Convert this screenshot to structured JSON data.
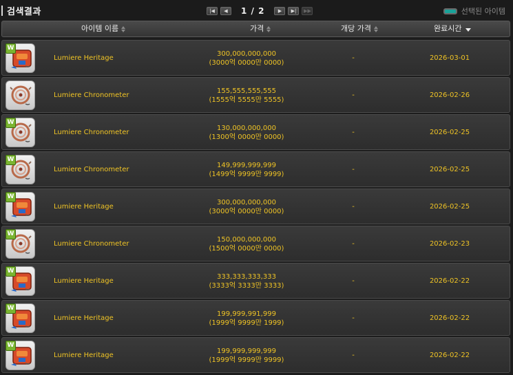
{
  "header": {
    "title": "검색결과",
    "page_current": "1",
    "page_sep": "/",
    "page_total": "2",
    "selected_legend_label": "선택된 아이템",
    "selected_color": "#1aa39a"
  },
  "columns": {
    "name": "아이템 이름",
    "price": "가격",
    "unit_price": "개당 가격",
    "end_time": "완료시간"
  },
  "colors": {
    "accent_text": "#f0c425",
    "badge_green": "#7bb531"
  },
  "rows": [
    {
      "badge": "W",
      "icon": "heritage-icon",
      "name": "Lumiere Heritage",
      "price": "300,000,000,000",
      "price_kr": "(3000억 0000만 0000)",
      "unit_price": "-",
      "date": "2026-03-01"
    },
    {
      "badge": "",
      "icon": "chronometer-icon",
      "name": "Lumiere Chronometer",
      "price": "155,555,555,555",
      "price_kr": "(1555억 5555만 5555)",
      "unit_price": "-",
      "date": "2026-02-26"
    },
    {
      "badge": "W",
      "icon": "chronometer-icon",
      "name": "Lumiere Chronometer",
      "price": "130,000,000,000",
      "price_kr": "(1300억 0000만 0000)",
      "unit_price": "-",
      "date": "2026-02-25"
    },
    {
      "badge": "W",
      "icon": "chronometer-icon",
      "name": "Lumiere Chronometer",
      "price": "149,999,999,999",
      "price_kr": "(1499억 9999만 9999)",
      "unit_price": "-",
      "date": "2026-02-25"
    },
    {
      "badge": "W",
      "icon": "heritage-icon",
      "name": "Lumiere Heritage",
      "price": "300,000,000,000",
      "price_kr": "(3000억 0000만 0000)",
      "unit_price": "-",
      "date": "2026-02-25"
    },
    {
      "badge": "W",
      "icon": "chronometer-icon",
      "name": "Lumiere Chronometer",
      "price": "150,000,000,000",
      "price_kr": "(1500억 0000만 0000)",
      "unit_price": "-",
      "date": "2026-02-23"
    },
    {
      "badge": "W",
      "icon": "heritage-icon",
      "name": "Lumiere Heritage",
      "price": "333,333,333,333",
      "price_kr": "(3333억 3333만 3333)",
      "unit_price": "-",
      "date": "2026-02-22"
    },
    {
      "badge": "W",
      "icon": "heritage-icon",
      "name": "Lumiere Heritage",
      "price": "199,999,991,999",
      "price_kr": "(1999억 9999만 1999)",
      "unit_price": "-",
      "date": "2026-02-22"
    },
    {
      "badge": "W",
      "icon": "heritage-icon",
      "name": "Lumiere Heritage",
      "price": "199,999,999,999",
      "price_kr": "(1999억 9999만 9999)",
      "unit_price": "-",
      "date": "2026-02-22"
    }
  ]
}
